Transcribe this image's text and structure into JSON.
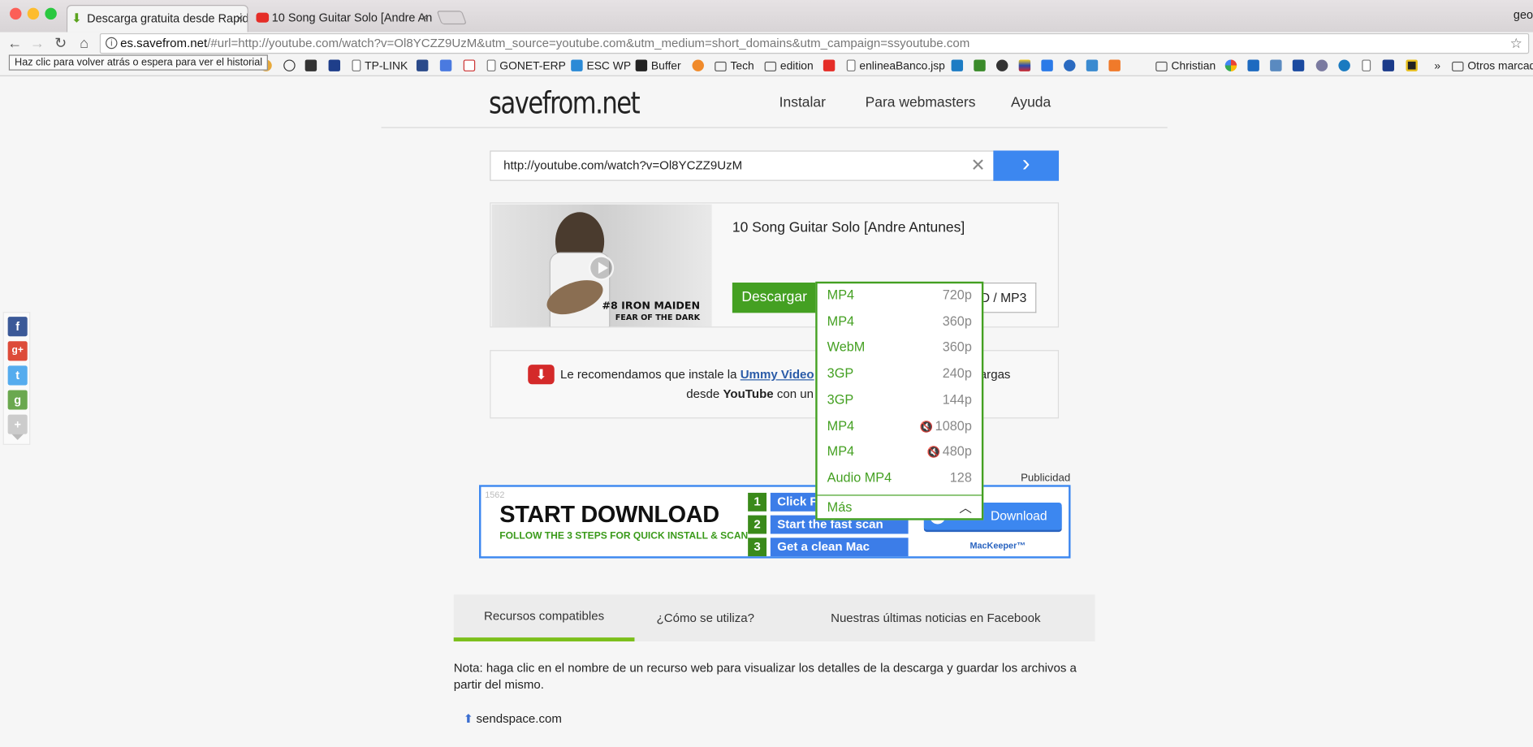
{
  "browser": {
    "tabs": [
      {
        "title": "Descarga gratuita desde Rapid"
      },
      {
        "title": "10 Song Guitar Solo [Andre An"
      }
    ],
    "close_glyph": "×",
    "profile": "geo",
    "url_host": "es.savefrom.net",
    "url_rest": "/#url=http://youtube.com/watch?v=Ol8YCZZ9UzM&utm_source=youtube.com&utm_medium=short_domains&utm_campaign=ssyoutube.com",
    "back_tooltip": "Haz clic para volver atrás o espera para ver el historial",
    "bookmarks": [
      "TP-LINK",
      "GONET-ERP",
      "ESC WP",
      "Buffer",
      "Tech",
      "edition",
      "enlineaBanco.jsp",
      "Christian",
      "Otros marcadores"
    ]
  },
  "site": {
    "logo": "savefrom.net",
    "nav": [
      "Instalar",
      "Para webmasters",
      "Ayuda"
    ]
  },
  "search": {
    "value": "http://youtube.com/watch?v=Ol8YCZZ9UzM",
    "clear_glyph": "✕",
    "go_glyph": "›"
  },
  "result": {
    "title": "10 Song Guitar Solo [Andre Antunes]",
    "thumb_caption1": "#8 IRON MAIDEN",
    "thumb_caption2": "FEAR OF THE DARK",
    "download_label": "Descargar",
    "secondary_label": "D / MP3"
  },
  "formats": {
    "options": [
      {
        "format": "MP4",
        "quality": "720p",
        "muted": false
      },
      {
        "format": "MP4",
        "quality": "360p",
        "muted": false
      },
      {
        "format": "WebM",
        "quality": "360p",
        "muted": false
      },
      {
        "format": "3GP",
        "quality": "240p",
        "muted": false
      },
      {
        "format": "3GP",
        "quality": "144p",
        "muted": false
      },
      {
        "format": "MP4",
        "quality": "1080p",
        "muted": true
      },
      {
        "format": "MP4",
        "quality": "480p",
        "muted": true
      },
      {
        "format": "Audio MP4",
        "quality": "128",
        "muted": false
      }
    ],
    "more_label": "Más"
  },
  "notice": {
    "text_before": "Le recomendamos que instale la",
    "link": "Ummy Video",
    "text_after_right": "cargas",
    "line2_before": "desde",
    "line2_bold": "YouTube",
    "line2_after": "con un"
  },
  "ad": {
    "label": "Publicidad",
    "number": "1562",
    "headline": "START DOWNLOAD",
    "subline": "FOLLOW THE 3 STEPS FOR QUICK INSTALL & SCAN",
    "steps": [
      {
        "n": "1",
        "text": "Click F"
      },
      {
        "n": "2",
        "text": "Start the fast scan"
      },
      {
        "n": "3",
        "text": "Get a clean Mac"
      }
    ],
    "button": "Download",
    "brand": "MacKeeper™"
  },
  "info": {
    "tabs": [
      "Recursos compatibles",
      "¿Cómo se utiliza?",
      "Nuestras últimas noticias en Facebook"
    ],
    "active_tab": 0,
    "note": "Nota: haga clic en el nombre de un recurso web para visualizar los detalles de la descarga y guardar los archivos a partir del mismo.",
    "resource": "sendspace.com"
  },
  "colors": {
    "accent_green": "#44a022",
    "accent_blue": "#3c87f0",
    "tab_underline": "#7bbf1a"
  }
}
